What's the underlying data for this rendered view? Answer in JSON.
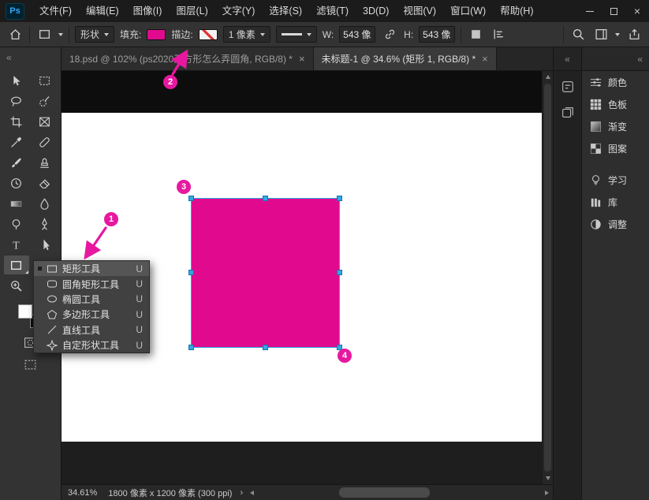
{
  "colors": {
    "fill_magenta": "#e10a8e",
    "annotation_pink": "#e7189f",
    "selection_blue": "#2ba3e2",
    "logo_blue": "#31a8ff"
  },
  "titlebar": {
    "logo": "Ps",
    "menus": [
      "文件(F)",
      "编辑(E)",
      "图像(I)",
      "图层(L)",
      "文字(Y)",
      "选择(S)",
      "滤镜(T)",
      "3D(D)",
      "视图(V)",
      "窗口(W)",
      "帮助(H)"
    ]
  },
  "options_bar": {
    "tool_mode": "形状",
    "fill_label": "填充:",
    "stroke_label": "描边:",
    "stroke_width": "1 像素",
    "w_label": "W:",
    "w_value": "543 像",
    "h_label": "H:",
    "h_value": "543 像"
  },
  "tabs": [
    {
      "title": "18.psd @ 102% (ps2020正方形怎么弄圆角, RGB/8) *",
      "close": "×"
    },
    {
      "title": "未标题-1 @ 34.6% (矩形 1, RGB/8) *",
      "close": "×"
    }
  ],
  "tool_flyout": {
    "items": [
      {
        "label": "矩形工具",
        "shortcut": "U"
      },
      {
        "label": "圆角矩形工具",
        "shortcut": "U"
      },
      {
        "label": "椭圆工具",
        "shortcut": "U"
      },
      {
        "label": "多边形工具",
        "shortcut": "U"
      },
      {
        "label": "直线工具",
        "shortcut": "U"
      },
      {
        "label": "自定形状工具",
        "shortcut": "U"
      }
    ]
  },
  "right_panels": {
    "buttons": [
      {
        "label": "颜色"
      },
      {
        "label": "色板"
      },
      {
        "label": "渐变"
      },
      {
        "label": "图案"
      },
      {
        "label": "学习"
      },
      {
        "label": "库"
      },
      {
        "label": "调整"
      }
    ]
  },
  "statusbar": {
    "zoom": "34.61%",
    "doc_info": "1800 像素 x 1200 像素 (300 ppi)",
    "chevron": "›"
  },
  "annotations": {
    "step1": "1",
    "step2": "2",
    "step3": "3",
    "step4": "4"
  },
  "icons": {
    "collapse": "«"
  }
}
